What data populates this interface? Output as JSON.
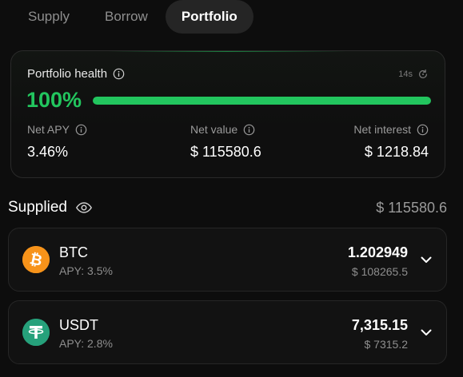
{
  "tabs": [
    {
      "label": "Supply",
      "active": false
    },
    {
      "label": "Borrow",
      "active": false
    },
    {
      "label": "Portfolio",
      "active": true
    }
  ],
  "health": {
    "title": "Portfolio health",
    "refresh_time": "14s",
    "percent_text": "100%",
    "percent_value": 100,
    "metrics": [
      {
        "label": "Net APY",
        "value": "3.46%"
      },
      {
        "label": "Net value",
        "value": "$ 115580.6"
      },
      {
        "label": "Net interest",
        "value": "$ 1218.84"
      }
    ]
  },
  "supplied": {
    "title": "Supplied",
    "total": "$ 115580.6",
    "assets": [
      {
        "symbol": "BTC",
        "apy": "APY: 3.5%",
        "amount": "1.202949",
        "usd": "$ 108265.5",
        "icon": "bitcoin-icon",
        "color": "#f7931a"
      },
      {
        "symbol": "USDT",
        "apy": "APY: 2.8%",
        "amount": "7,315.15",
        "usd": "$ 7315.2",
        "icon": "tether-icon",
        "color": "#26a17b"
      }
    ]
  },
  "colors": {
    "accent_green": "#22c55e",
    "background": "#0d0d0d",
    "card": "#121212"
  }
}
